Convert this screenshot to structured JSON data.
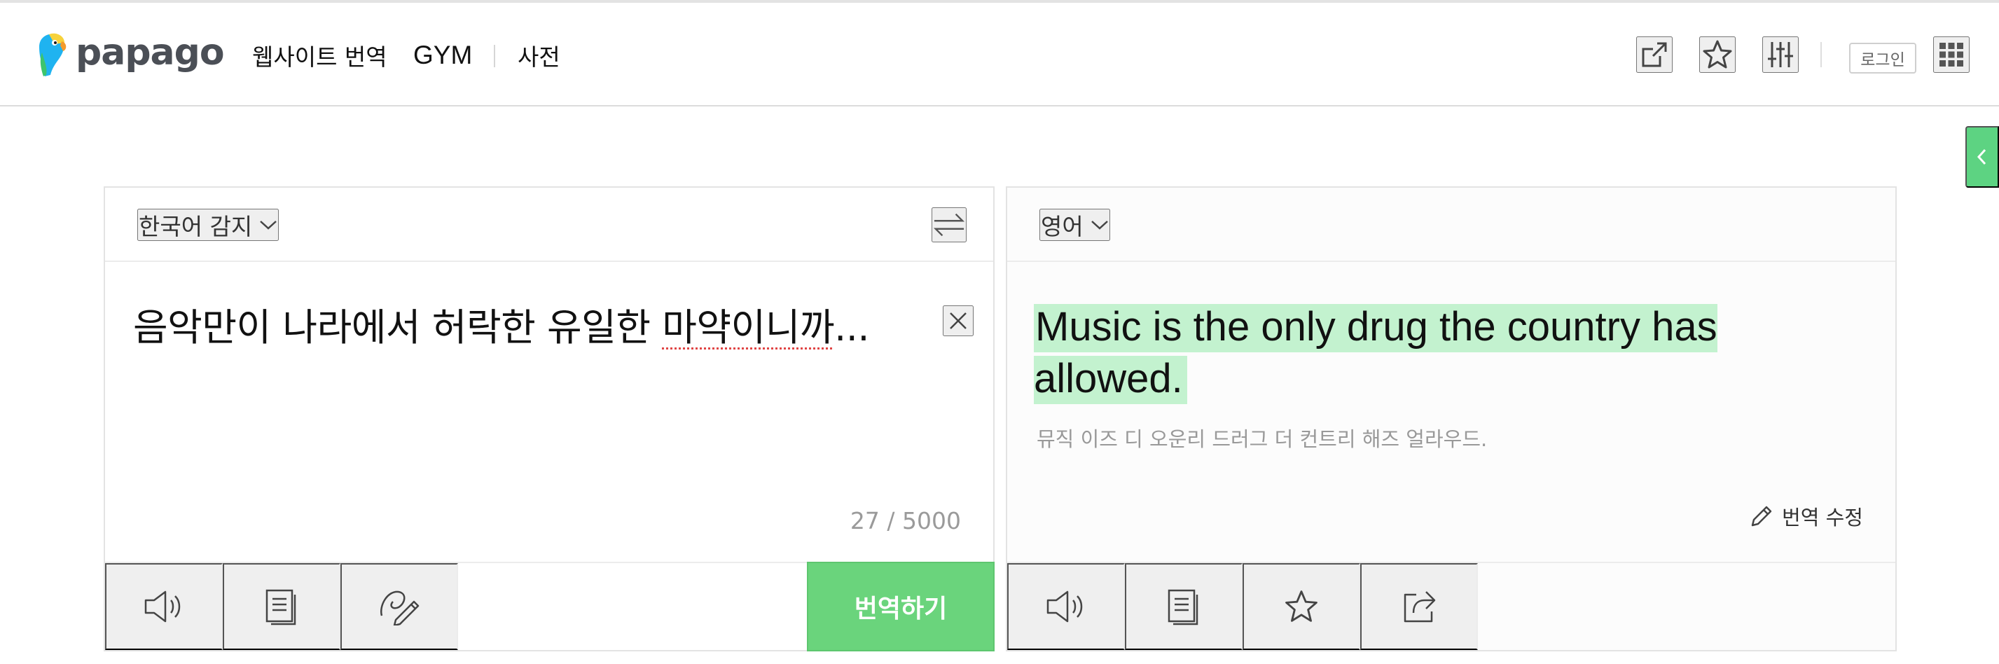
{
  "header": {
    "logo_text": "papago",
    "nav": {
      "website_translate": "웹사이트 번역",
      "gym": "GYM",
      "dictionary": "사전"
    },
    "icons": [
      "external-link-icon",
      "star-icon",
      "settings-sliders-icon",
      "apps-grid-icon"
    ],
    "login_label": "로그인"
  },
  "source": {
    "language_label": "한국어 감지",
    "text_before_highlight": "음악만이 나라에서 허락한 유일한 ",
    "text_misspelled": "마약이니까",
    "text_after_highlight": "...",
    "char_count": "27 / 5000",
    "translate_button": "번역하기"
  },
  "target": {
    "language_label": "영어",
    "translation": "Music is the only drug the country has allowed.",
    "pronunciation": "뮤직 이즈 디 오운리 드러그 더 컨트리 해즈 얼라우드.",
    "edit_label": "번역 수정"
  },
  "colors": {
    "accent_green": "#6ad47c",
    "highlight_green": "#c3f2cf",
    "side_tab_green": "#5dd382"
  }
}
